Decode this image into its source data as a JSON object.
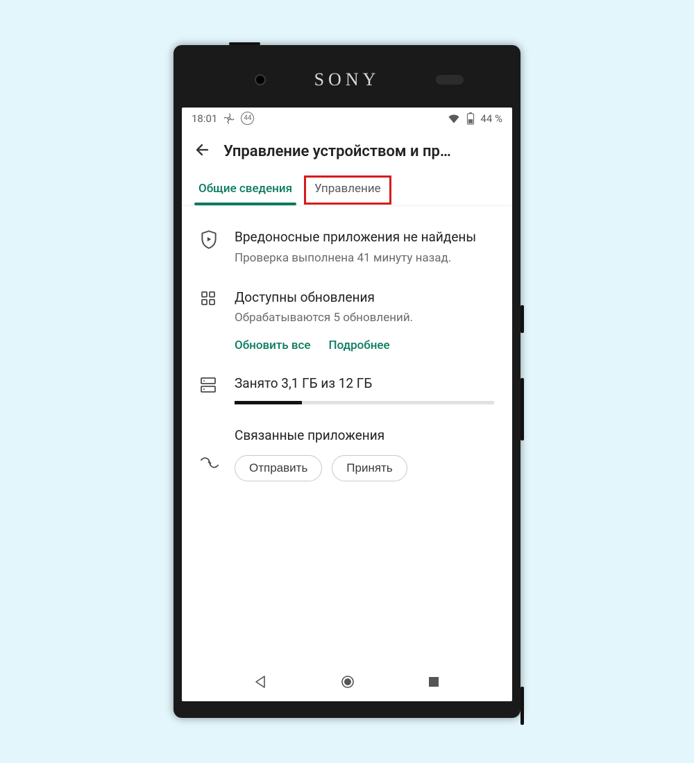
{
  "device": {
    "brand": "SONY"
  },
  "status": {
    "time": "18:01",
    "badge": "44",
    "battery_text": "44 %"
  },
  "header": {
    "title": "Управление устройством и пр…"
  },
  "tabs": {
    "overview": "Общие сведения",
    "manage": "Управление"
  },
  "protect": {
    "title": "Вредоносные приложения не найдены",
    "sub": "Проверка выполнена 41 минуту назад."
  },
  "updates": {
    "title": "Доступны обновления",
    "sub": "Обрабатываются 5 обновлений.",
    "update_all": "Обновить все",
    "details": "Подробнее"
  },
  "storage": {
    "text": "Занято 3,1 ГБ из 12 ГБ",
    "used": 3.1,
    "total": 12
  },
  "linked": {
    "title": "Связанные приложения",
    "send": "Отправить",
    "receive": "Принять"
  }
}
